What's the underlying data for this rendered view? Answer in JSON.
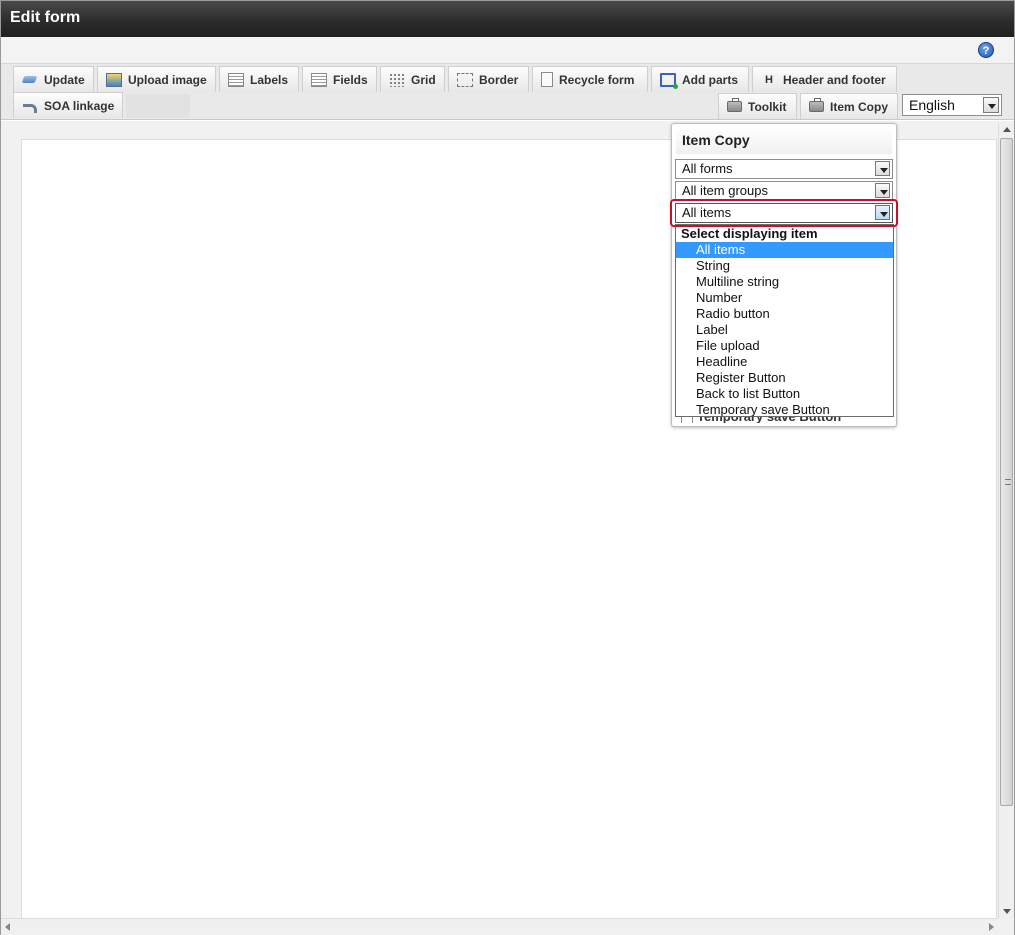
{
  "window": {
    "title": "Edit form"
  },
  "toolbar": {
    "tabs": [
      {
        "label": "Update",
        "icon": "update-icon"
      },
      {
        "label": "Upload image",
        "icon": "upload-image-icon"
      },
      {
        "label": "Labels",
        "icon": "labels-icon"
      },
      {
        "label": "Fields",
        "icon": "fields-icon"
      },
      {
        "label": "Grid",
        "icon": "grid-icon"
      },
      {
        "label": "Border",
        "icon": "border-icon"
      },
      {
        "label": "Recycle form",
        "icon": "recycle-form-icon"
      },
      {
        "label": "Add parts",
        "icon": "add-parts-icon"
      },
      {
        "label": "Header and footer",
        "icon": "header-footer-icon"
      },
      {
        "label": "SOA linkage",
        "icon": "soa-linkage-icon"
      },
      {
        "label": "Toolkit",
        "icon": "toolkit-icon"
      },
      {
        "label": "Item Copy",
        "icon": "item-copy-icon"
      }
    ],
    "language": "English"
  },
  "help": {
    "glyph": "?"
  },
  "item_copy": {
    "title": "Item Copy",
    "form_filter": "All forms",
    "group_filter": "All item groups",
    "item_filter": "All items",
    "dropdown": {
      "group_label": "Select displaying item",
      "options": [
        "All items",
        "String",
        "Multiline string",
        "Number",
        "Radio button",
        "Label",
        "File upload",
        "Headline",
        "Register Button",
        "Back to list Button",
        "Temporary save Button"
      ],
      "selected_index": 0
    },
    "underlying_item": "Temporary save Button"
  },
  "colors": {
    "title_bar": "#2c2c2c",
    "selected_option": "#3399ff",
    "highlight_ring": "#c8102e",
    "help_icon": "#1f57b5"
  }
}
